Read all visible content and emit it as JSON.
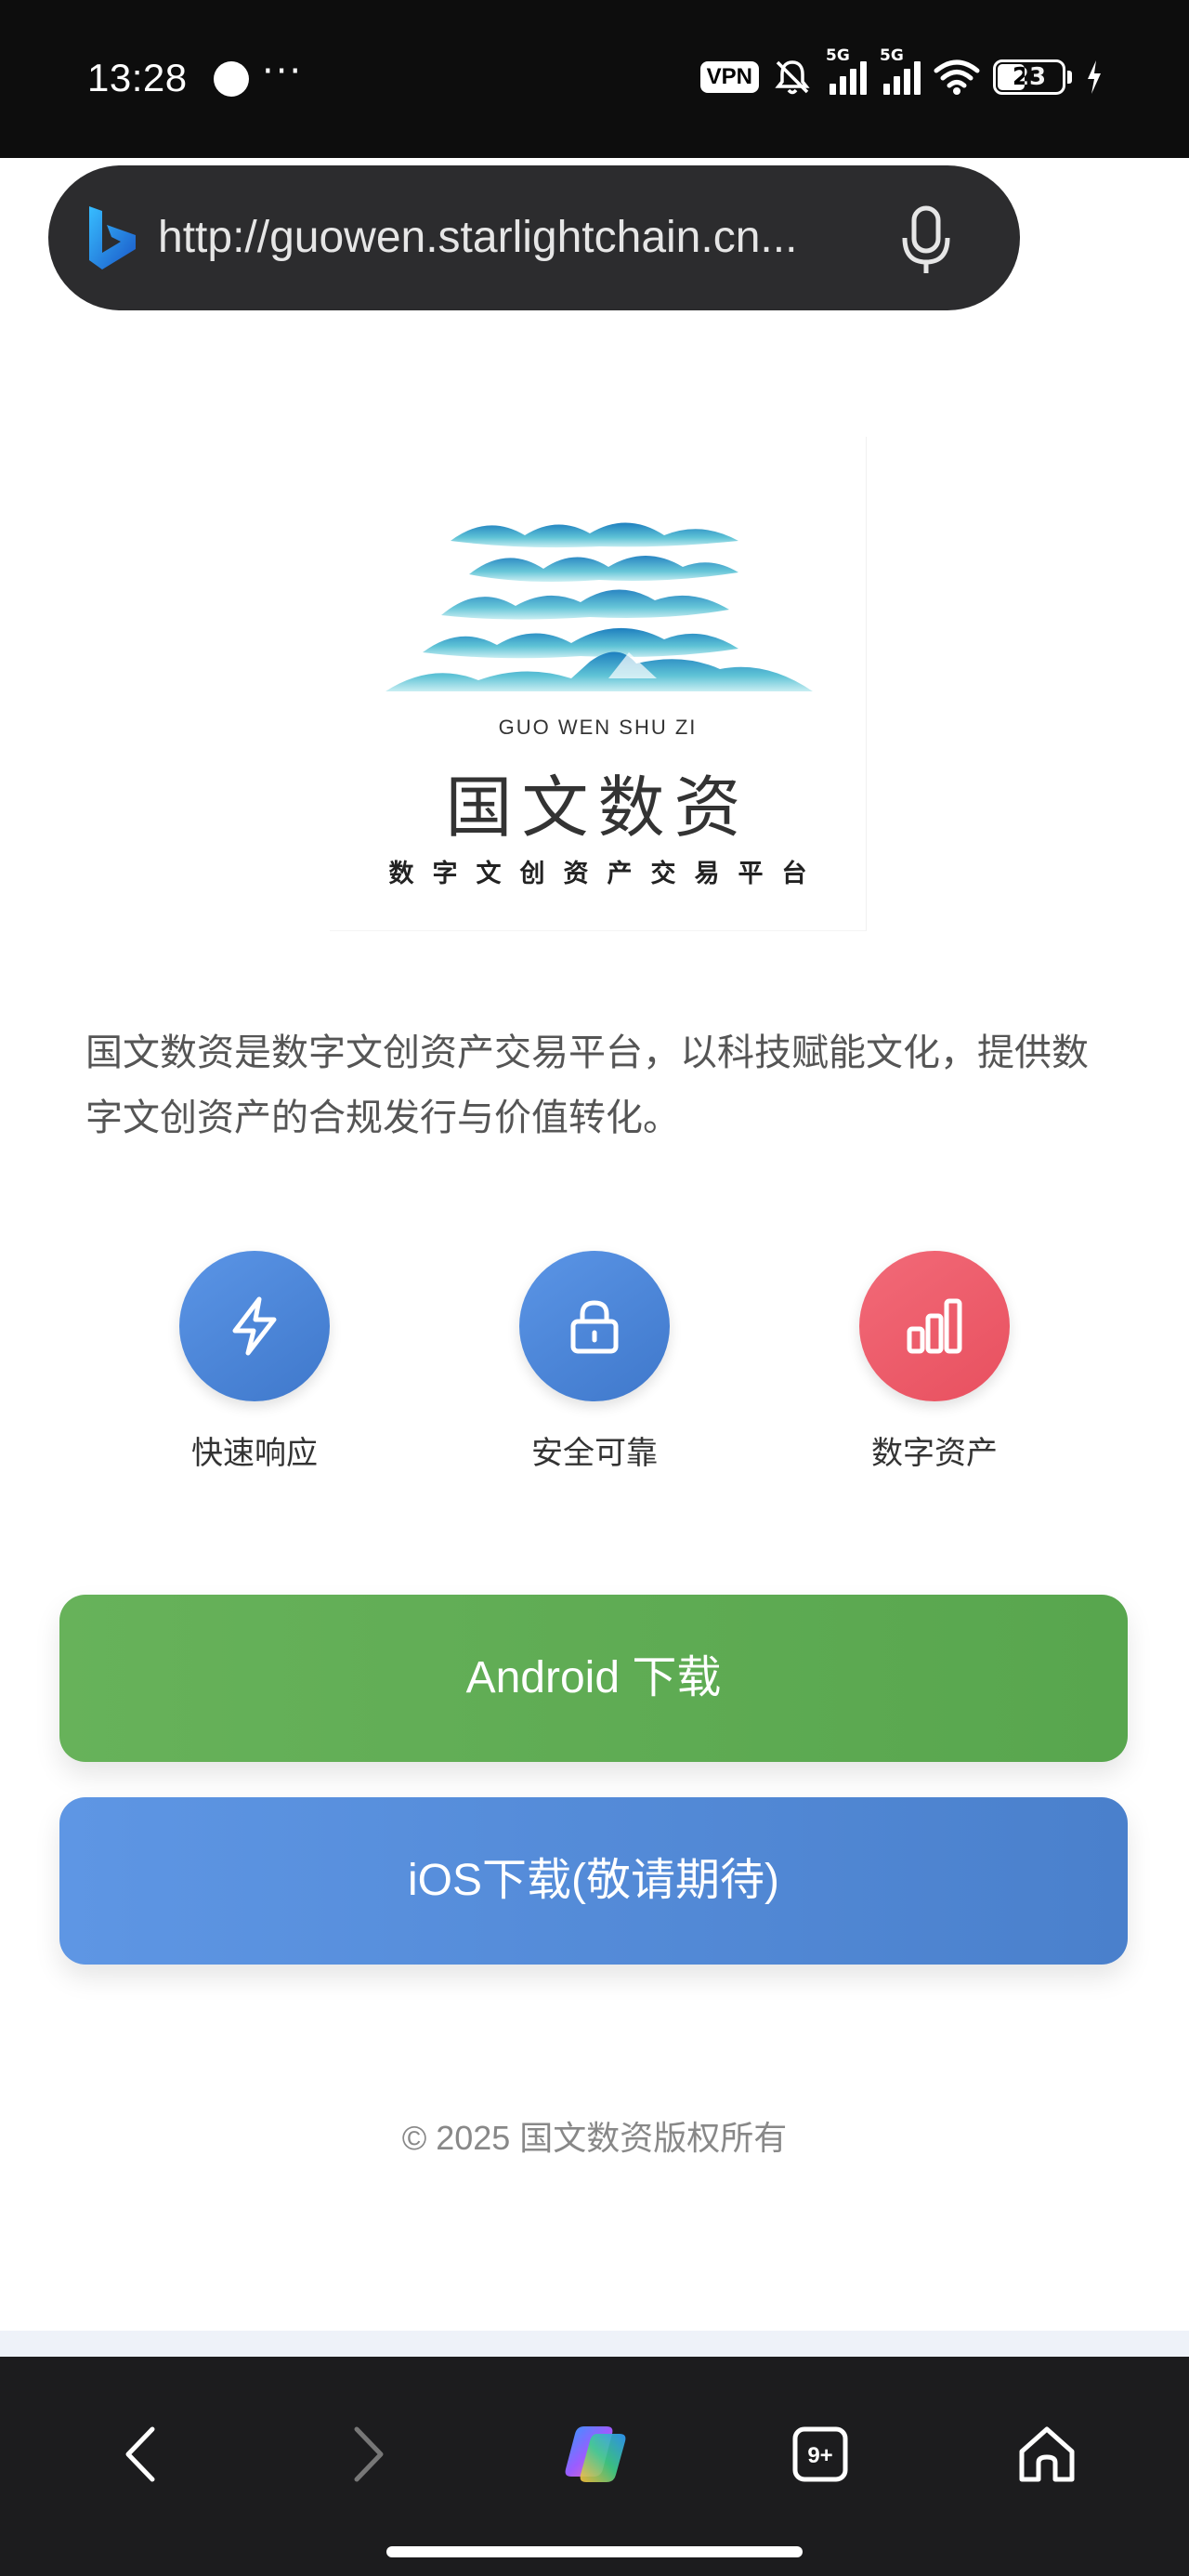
{
  "status_bar": {
    "time": "13:28",
    "more": "···",
    "vpn": "VPN",
    "net1": "5G",
    "net2": "5G",
    "battery": "23"
  },
  "browser": {
    "url": "http://guowen.starlightchain.cn...",
    "icons": {
      "engine": "bing-icon",
      "voice": "mic-icon",
      "menu": "more-dots-icon"
    },
    "tabs_count": "9+"
  },
  "logo": {
    "en": "GUO WEN SHU ZI",
    "cn": "国文数资",
    "sub": "数字文创资产交易平台"
  },
  "intro": "国文数资是数字文创资产交易平台，以科技赋能文化，提供数字文创资产的合规发行与价值转化。",
  "features": [
    {
      "label": "快速响应",
      "icon": "lightning-icon",
      "color": "#4a86d8"
    },
    {
      "label": "安全可靠",
      "icon": "lock-icon",
      "color": "#4a86d8"
    },
    {
      "label": "数字资产",
      "icon": "bar-chart-icon",
      "color": "#ec5a68"
    }
  ],
  "buttons": {
    "android": "Android 下载",
    "ios": "iOS下载(敬请期待)"
  },
  "footer": "© 2025 国文数资版权所有",
  "colors": {
    "android_button": "#5fab53",
    "ios_button": "#5189d8",
    "browser_chrome": "#0d0d0d"
  }
}
